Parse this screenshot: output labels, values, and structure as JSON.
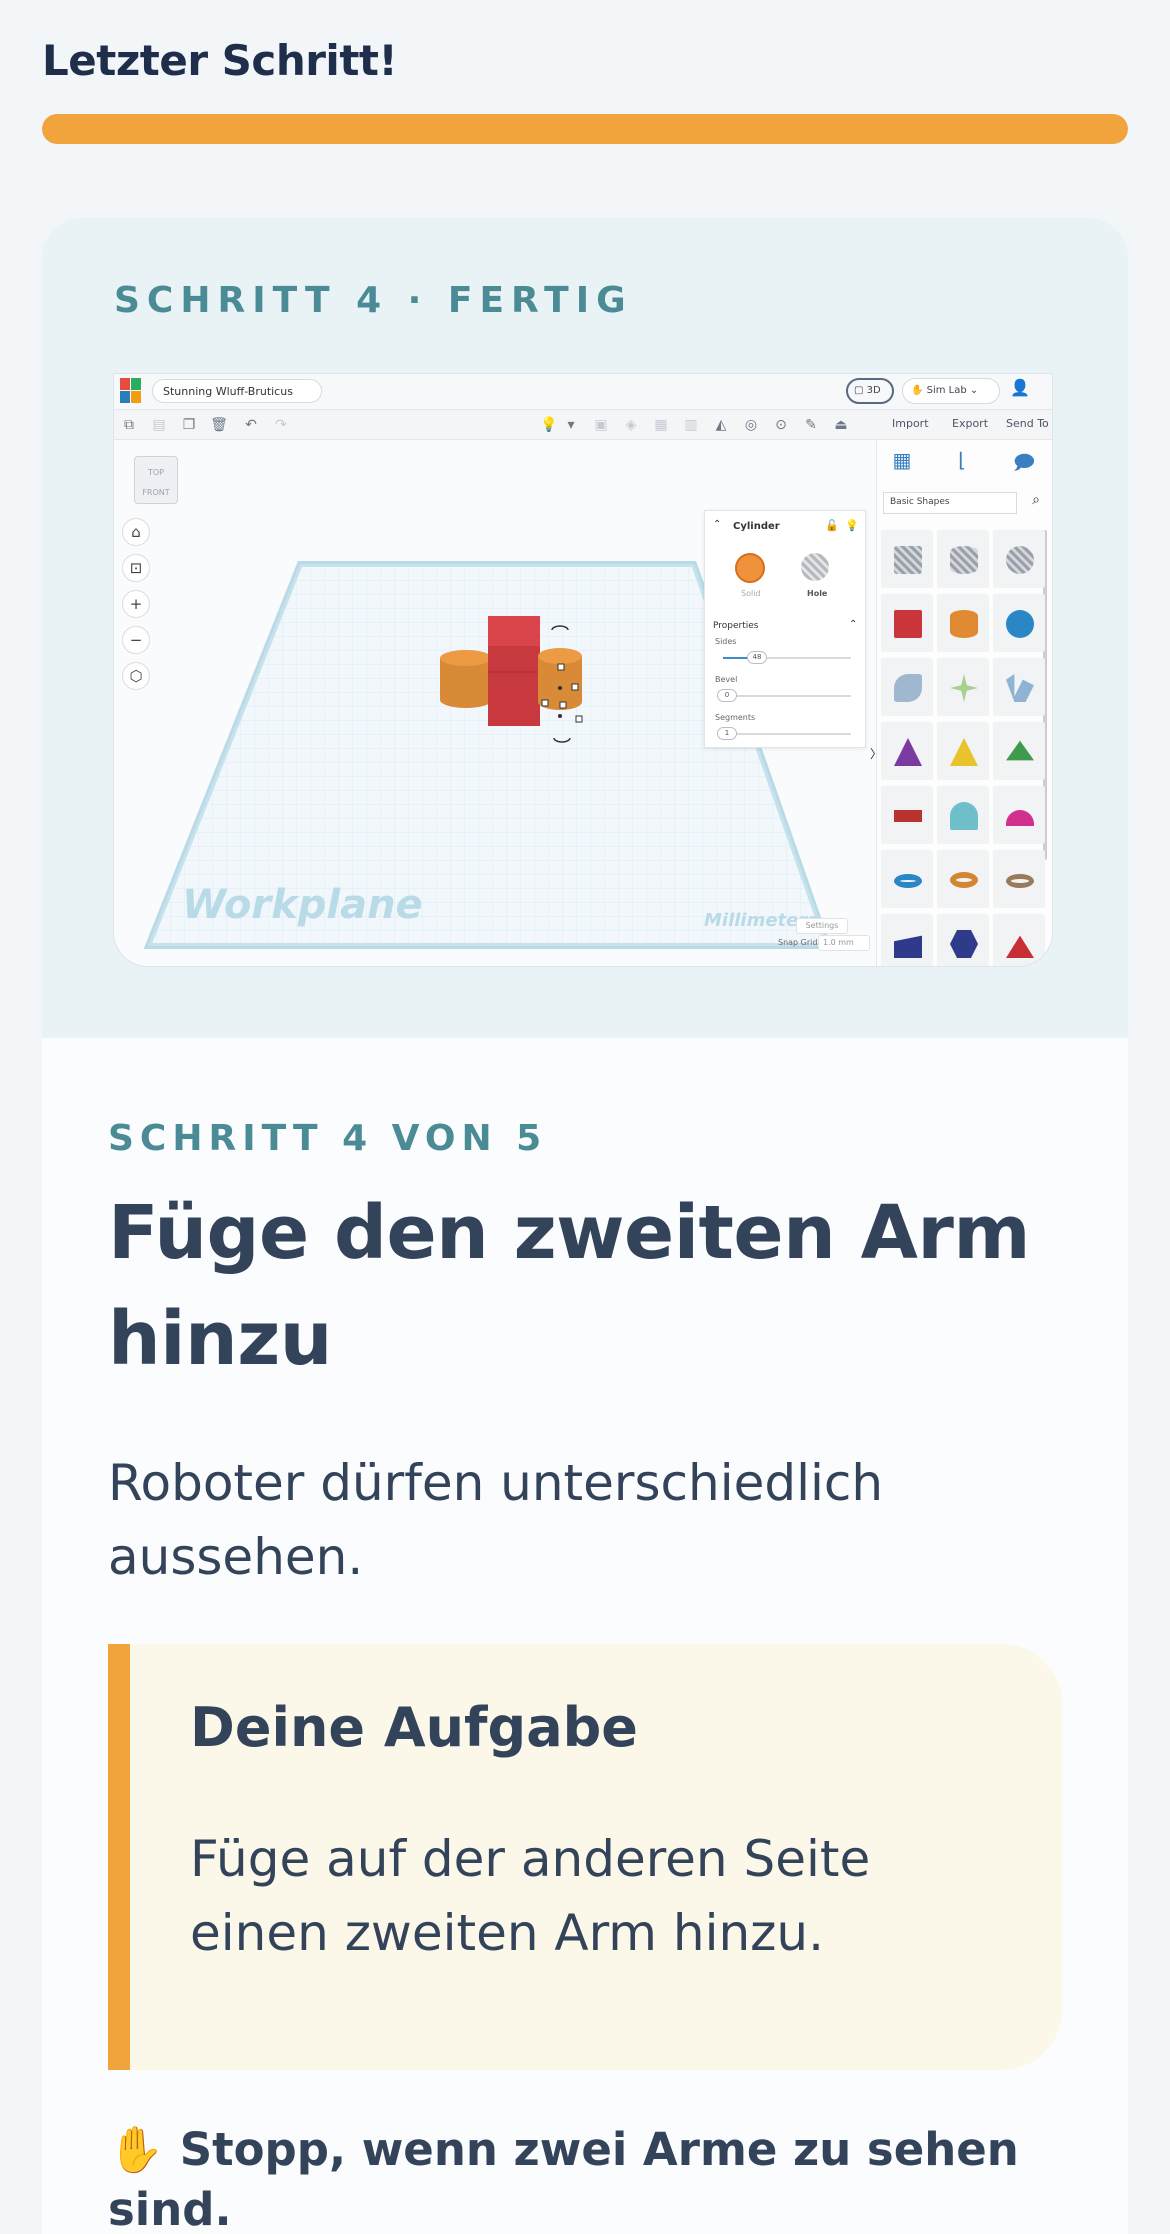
{
  "header": {
    "title": "Letzter Schritt!",
    "progress_percent": 100,
    "progress_color": "#f2a43c"
  },
  "hero": {
    "label": "SCHRITT 4 · FERTIG"
  },
  "screenshot": {
    "project_name": "Stunning Wluff-Bruticus",
    "view_3d_label": "3D",
    "sim_lab_label": "Sim Lab",
    "toolbar": {
      "import": "Import",
      "export": "Export",
      "send_to": "Send To"
    },
    "viewcube": {
      "top": "TOP",
      "front": "FRONT"
    },
    "inspector": {
      "title": "Cylinder",
      "solid_label": "Solid",
      "hole_label": "Hole",
      "properties_label": "Properties",
      "sides_label": "Sides",
      "sides_value": "48",
      "bevel_label": "Bevel",
      "bevel_value": "0",
      "segments_label": "Segments",
      "segments_value": "1"
    },
    "library": {
      "category": "Basic Shapes"
    },
    "workplane_label": "Workplane",
    "units_label": "Millimeters",
    "settings_label": "Settings",
    "snap_grid_label": "Snap Grid",
    "snap_grid_value": "1.0 mm"
  },
  "lesson": {
    "step_label": "SCHRITT 4 VON 5",
    "heading": "Füge den zweiten Arm hinzu",
    "lead": "Roboter dürfen unterschiedlich aussehen.",
    "task_title": "Deine Aufgabe",
    "task_body": "Füge auf der anderen Seite einen zweiten Arm hinzu.",
    "stop_icon": "✋",
    "stop_text": "Stopp, wenn zwei Arme zu sehen sind."
  }
}
